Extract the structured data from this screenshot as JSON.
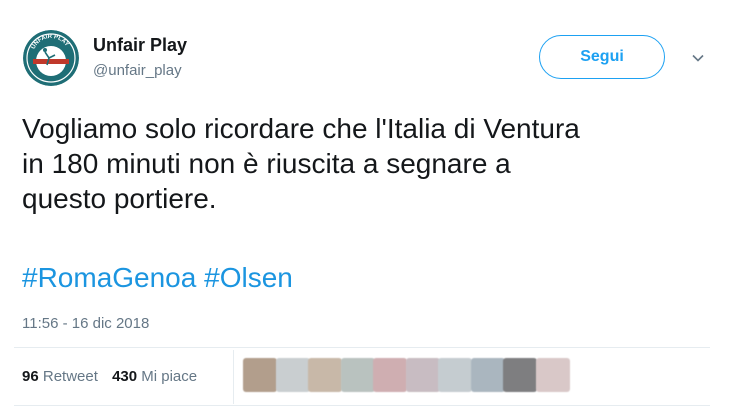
{
  "author": {
    "name": "Unfair Play",
    "handle": "@unfair_play",
    "avatar_logo_text": "UNFAIR PLAY"
  },
  "follow_button": {
    "label": "Segui"
  },
  "more_menu": {
    "icon": "chevron-down-icon"
  },
  "tweet": {
    "lines": [
      "Vogliamo solo ricordare che l'Italia di Ventura",
      "in 180 minuti non è riuscita a segnare a",
      "questo portiere."
    ],
    "hashtags": [
      "#RomaGenoa",
      "#Olsen"
    ]
  },
  "timestamp": "11:56 - 16 dic 2018",
  "stats": {
    "retweets_count": "96",
    "retweets_label": "Retweet",
    "likes_count": "430",
    "likes_label": "Mi piace"
  },
  "liker_avatars": {
    "count": 10,
    "colors": [
      "#b29e8c",
      "#c9ced0",
      "#c8b8a8",
      "#b9c2bf",
      "#cfaeb1",
      "#c8bcc2",
      "#c5ccd0",
      "#aab6bf",
      "#7e7e80",
      "#d9c8c8"
    ]
  },
  "colors": {
    "accent": "#1da1f2",
    "hashtag": "#1b95e0",
    "text": "#14171a",
    "secondary_text": "#657786",
    "avatar_bg": "#1f6e76"
  }
}
